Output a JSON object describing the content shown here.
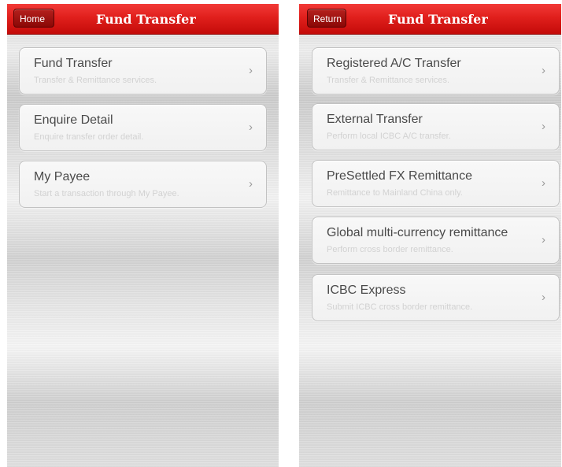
{
  "left_screen": {
    "header": {
      "nav_button": "Home",
      "title": "Fund Transfer"
    },
    "items": [
      {
        "title": "Fund Transfer",
        "subtitle": "Transfer & Remittance services."
      },
      {
        "title": "Enquire Detail",
        "subtitle": "Enquire transfer order detail."
      },
      {
        "title": "My Payee",
        "subtitle": "Start a transaction through My Payee."
      }
    ]
  },
  "right_screen": {
    "header": {
      "nav_button": "Return",
      "title": "Fund Transfer"
    },
    "items": [
      {
        "title": "Registered A/C Transfer",
        "subtitle": "Transfer & Remittance services."
      },
      {
        "title": "External Transfer",
        "subtitle": "Perform local ICBC A/C transfer."
      },
      {
        "title": "PreSettled FX Remittance",
        "subtitle": "Remittance to Mainland China only."
      },
      {
        "title": "Global multi-currency remittance",
        "subtitle": "Perform cross border remittance."
      },
      {
        "title": "ICBC Express",
        "subtitle": "Submit ICBC cross border remittance."
      }
    ]
  },
  "icons": {
    "chevron": "›"
  },
  "colors": {
    "header_red": "#e01f1c",
    "button_dark_red": "#8a0806"
  }
}
